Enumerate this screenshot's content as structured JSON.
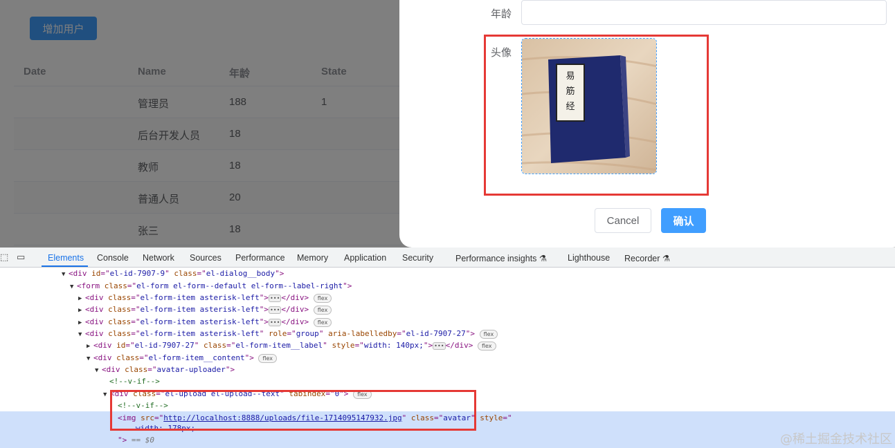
{
  "app": {
    "add_user_button": "增加用户",
    "table": {
      "headers": [
        "Date",
        "Name",
        "年龄",
        "State"
      ],
      "rows": [
        {
          "date": "",
          "name": "管理员",
          "age": "188",
          "state": "1"
        },
        {
          "date": "",
          "name": "后台开发人员",
          "age": "18",
          "state": ""
        },
        {
          "date": "",
          "name": "教师",
          "age": "18",
          "state": ""
        },
        {
          "date": "",
          "name": "普通人员",
          "age": "20",
          "state": ""
        },
        {
          "date": "",
          "name": "张三",
          "age": "18",
          "state": ""
        }
      ]
    },
    "dialog": {
      "age_label": "年龄",
      "age_value": "",
      "avatar_label": "头像",
      "book_title": "易筋经",
      "cancel_label": "Cancel",
      "confirm_label": "确认"
    }
  },
  "devtools": {
    "tabs": [
      "Elements",
      "Console",
      "Network",
      "Sources",
      "Performance",
      "Memory",
      "Application",
      "Security",
      "Performance insights",
      "Lighthouse",
      "Recorder"
    ],
    "active_tab": "Elements",
    "accent_color": "#1a73e8",
    "lines": {
      "l1_id": "el-id-7907-9",
      "l1_class": "el-dialog__body",
      "l2_class": "el-form el-form--default el-form--label-right",
      "item_class": "el-form-item asterisk-left",
      "l6_role": "group",
      "l6_labelledby": "el-id-7907-27",
      "l7_id": "el-id-7907-27",
      "l7_class": "el-form-item__label",
      "l7_style": "width: 140px;",
      "l8_class": "el-form-item__content",
      "l9_class": "avatar-uploader",
      "comment": "<!--v-if-->",
      "l11_class": "el-upload el-upload--text",
      "l11_tabindex": "0",
      "img_src": "http://localhost:8888/uploads/file-1714095147932.jpg",
      "img_class": "avatar",
      "img_style_line": "width: 178px;",
      "eq_marker": "== $0",
      "pill": "flex"
    }
  },
  "watermark": "@稀土掘金技术社区"
}
